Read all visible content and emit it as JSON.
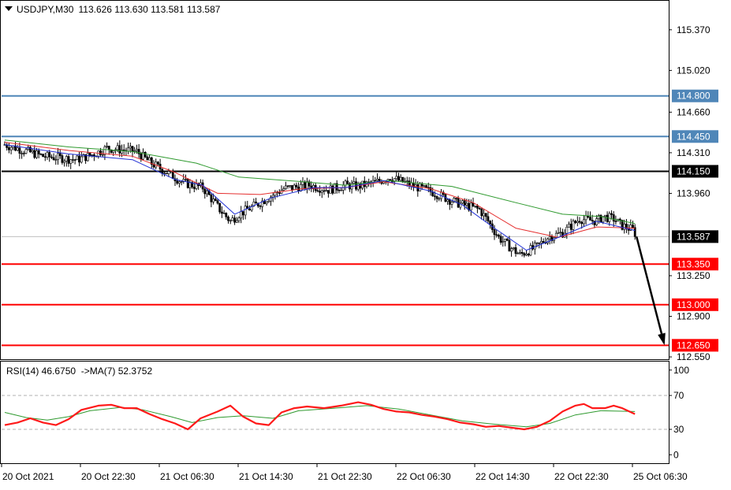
{
  "header": {
    "symbol": "USDJPY,M30",
    "ohlc": "113.626 113.630 113.581 113.587"
  },
  "rsi_header": {
    "text": "RSI(14) 46.6750",
    "ma_text": "->MA(7) 52.3752"
  },
  "colors": {
    "bull": "#ffffff",
    "bear": "#000000",
    "ma_fast": "#1f2fd6",
    "ma_mid": "#e52f2f",
    "ma_slow": "#2f9a2f",
    "rsi": "#ff1a1a",
    "rsi_ma": "#2f9a2f",
    "support": "#ff0000",
    "resistance": "#4f86b8",
    "pivot": "#000000",
    "current": "#000000",
    "arrow": "#000000"
  },
  "chart_data": [
    {
      "type": "candlestick",
      "symbol": "USDJPY",
      "timeframe": "M30",
      "ylim": [
        112.53,
        115.62
      ],
      "y_ticks": [
        115.37,
        115.02,
        114.66,
        114.31,
        113.96,
        113.25,
        112.9,
        112.55
      ],
      "x_labels": [
        "20 Oct 2021",
        "20 Oct 22:30",
        "21 Oct 06:30",
        "21 Oct 14:30",
        "21 Oct 22:30",
        "22 Oct 06:30",
        "22 Oct 14:30",
        "22 Oct 22:30",
        "25 Oct 06:30"
      ],
      "current_price": 113.587,
      "levels": [
        {
          "value": 114.8,
          "label": "114.800",
          "kind": "resistance"
        },
        {
          "value": 114.45,
          "label": "114.450",
          "kind": "resistance"
        },
        {
          "value": 114.15,
          "label": "114.150",
          "kind": "pivot"
        },
        {
          "value": 113.35,
          "label": "113.350",
          "kind": "support"
        },
        {
          "value": 113.0,
          "label": "113.000",
          "kind": "support"
        },
        {
          "value": 112.65,
          "label": "112.650",
          "kind": "support"
        }
      ],
      "projection": {
        "from": 113.587,
        "to": 112.65
      },
      "path_points": [
        [
          0,
          114.38
        ],
        [
          18,
          114.28
        ],
        [
          34,
          114.25
        ],
        [
          42,
          114.3
        ],
        [
          48,
          114.35
        ],
        [
          62,
          114.32
        ],
        [
          68,
          114.23
        ],
        [
          78,
          114.12
        ],
        [
          84,
          114.05
        ],
        [
          93,
          114.01
        ],
        [
          101,
          113.82
        ],
        [
          106,
          113.72
        ],
        [
          110,
          113.78
        ],
        [
          118,
          113.86
        ],
        [
          131,
          114.0
        ],
        [
          143,
          114.03
        ],
        [
          152,
          113.99
        ],
        [
          160,
          114.03
        ],
        [
          166,
          114.02
        ],
        [
          175,
          114.06
        ],
        [
          181,
          114.1
        ],
        [
          191,
          114.03
        ],
        [
          201,
          113.97
        ],
        [
          212,
          113.88
        ],
        [
          223,
          113.82
        ],
        [
          227,
          113.72
        ],
        [
          232,
          113.58
        ],
        [
          237,
          113.5
        ],
        [
          242,
          113.43
        ],
        [
          250,
          113.5
        ],
        [
          255,
          113.58
        ],
        [
          262,
          113.62
        ],
        [
          270,
          113.74
        ],
        [
          278,
          113.72
        ],
        [
          281,
          113.76
        ],
        [
          286,
          113.74
        ],
        [
          290,
          113.68
        ],
        [
          296,
          113.64
        ]
      ],
      "candle_count": 297,
      "ma_fast": [
        [
          0,
          114.38
        ],
        [
          30,
          114.3
        ],
        [
          60,
          114.25
        ],
        [
          80,
          114.08
        ],
        [
          93,
          114.03
        ],
        [
          108,
          113.78
        ],
        [
          125,
          113.92
        ],
        [
          145,
          114.01
        ],
        [
          160,
          114.01
        ],
        [
          178,
          114.07
        ],
        [
          200,
          113.98
        ],
        [
          215,
          113.86
        ],
        [
          230,
          113.66
        ],
        [
          245,
          113.47
        ],
        [
          260,
          113.58
        ],
        [
          278,
          113.72
        ],
        [
          296,
          113.64
        ]
      ],
      "ma_mid": [
        [
          0,
          114.4
        ],
        [
          30,
          114.33
        ],
        [
          60,
          114.28
        ],
        [
          80,
          114.14
        ],
        [
          100,
          113.96
        ],
        [
          120,
          113.95
        ],
        [
          140,
          114.0
        ],
        [
          160,
          114.01
        ],
        [
          178,
          114.06
        ],
        [
          200,
          114.0
        ],
        [
          220,
          113.88
        ],
        [
          240,
          113.66
        ],
        [
          260,
          113.58
        ],
        [
          278,
          113.67
        ],
        [
          296,
          113.66
        ]
      ],
      "ma_slow": [
        [
          0,
          114.42
        ],
        [
          30,
          114.36
        ],
        [
          60,
          114.32
        ],
        [
          90,
          114.22
        ],
        [
          110,
          114.1
        ],
        [
          140,
          114.06
        ],
        [
          160,
          114.03
        ],
        [
          180,
          114.07
        ],
        [
          210,
          114.02
        ],
        [
          240,
          113.88
        ],
        [
          262,
          113.78
        ],
        [
          280,
          113.76
        ],
        [
          296,
          113.7
        ]
      ]
    },
    {
      "type": "line",
      "indicator": "RSI(14)",
      "ylim": [
        -10,
        110
      ],
      "y_ticks": [
        100,
        70,
        30,
        0
      ],
      "levels": [
        70,
        30
      ],
      "rsi_points": [
        [
          0,
          35
        ],
        [
          6,
          38
        ],
        [
          12,
          43
        ],
        [
          18,
          38
        ],
        [
          24,
          35
        ],
        [
          30,
          42
        ],
        [
          36,
          53
        ],
        [
          44,
          58
        ],
        [
          50,
          59
        ],
        [
          56,
          55
        ],
        [
          62,
          55
        ],
        [
          68,
          48
        ],
        [
          74,
          42
        ],
        [
          80,
          37
        ],
        [
          86,
          30
        ],
        [
          92,
          43
        ],
        [
          100,
          51
        ],
        [
          106,
          58
        ],
        [
          112,
          45
        ],
        [
          118,
          37
        ],
        [
          124,
          35
        ],
        [
          130,
          50
        ],
        [
          136,
          55
        ],
        [
          142,
          57
        ],
        [
          150,
          55
        ],
        [
          158,
          58
        ],
        [
          166,
          62
        ],
        [
          172,
          59
        ],
        [
          178,
          54
        ],
        [
          184,
          51
        ],
        [
          190,
          50
        ],
        [
          196,
          47
        ],
        [
          202,
          45
        ],
        [
          208,
          42
        ],
        [
          214,
          38
        ],
        [
          220,
          36
        ],
        [
          226,
          33
        ],
        [
          232,
          34
        ],
        [
          238,
          32
        ],
        [
          244,
          30
        ],
        [
          250,
          33
        ],
        [
          256,
          40
        ],
        [
          262,
          51
        ],
        [
          268,
          58
        ],
        [
          272,
          60
        ],
        [
          276,
          55
        ],
        [
          282,
          55
        ],
        [
          286,
          58
        ],
        [
          290,
          55
        ],
        [
          296,
          48
        ]
      ],
      "rsi_ma_points": [
        [
          0,
          50
        ],
        [
          10,
          44
        ],
        [
          20,
          41
        ],
        [
          30,
          45
        ],
        [
          40,
          52
        ],
        [
          55,
          56
        ],
        [
          65,
          53
        ],
        [
          78,
          45
        ],
        [
          88,
          38
        ],
        [
          100,
          44
        ],
        [
          112,
          46
        ],
        [
          126,
          43
        ],
        [
          138,
          52
        ],
        [
          155,
          55
        ],
        [
          170,
          58
        ],
        [
          185,
          54
        ],
        [
          200,
          47
        ],
        [
          215,
          40
        ],
        [
          230,
          36
        ],
        [
          245,
          33
        ],
        [
          256,
          37
        ],
        [
          268,
          47
        ],
        [
          280,
          52
        ],
        [
          296,
          51
        ]
      ]
    }
  ]
}
